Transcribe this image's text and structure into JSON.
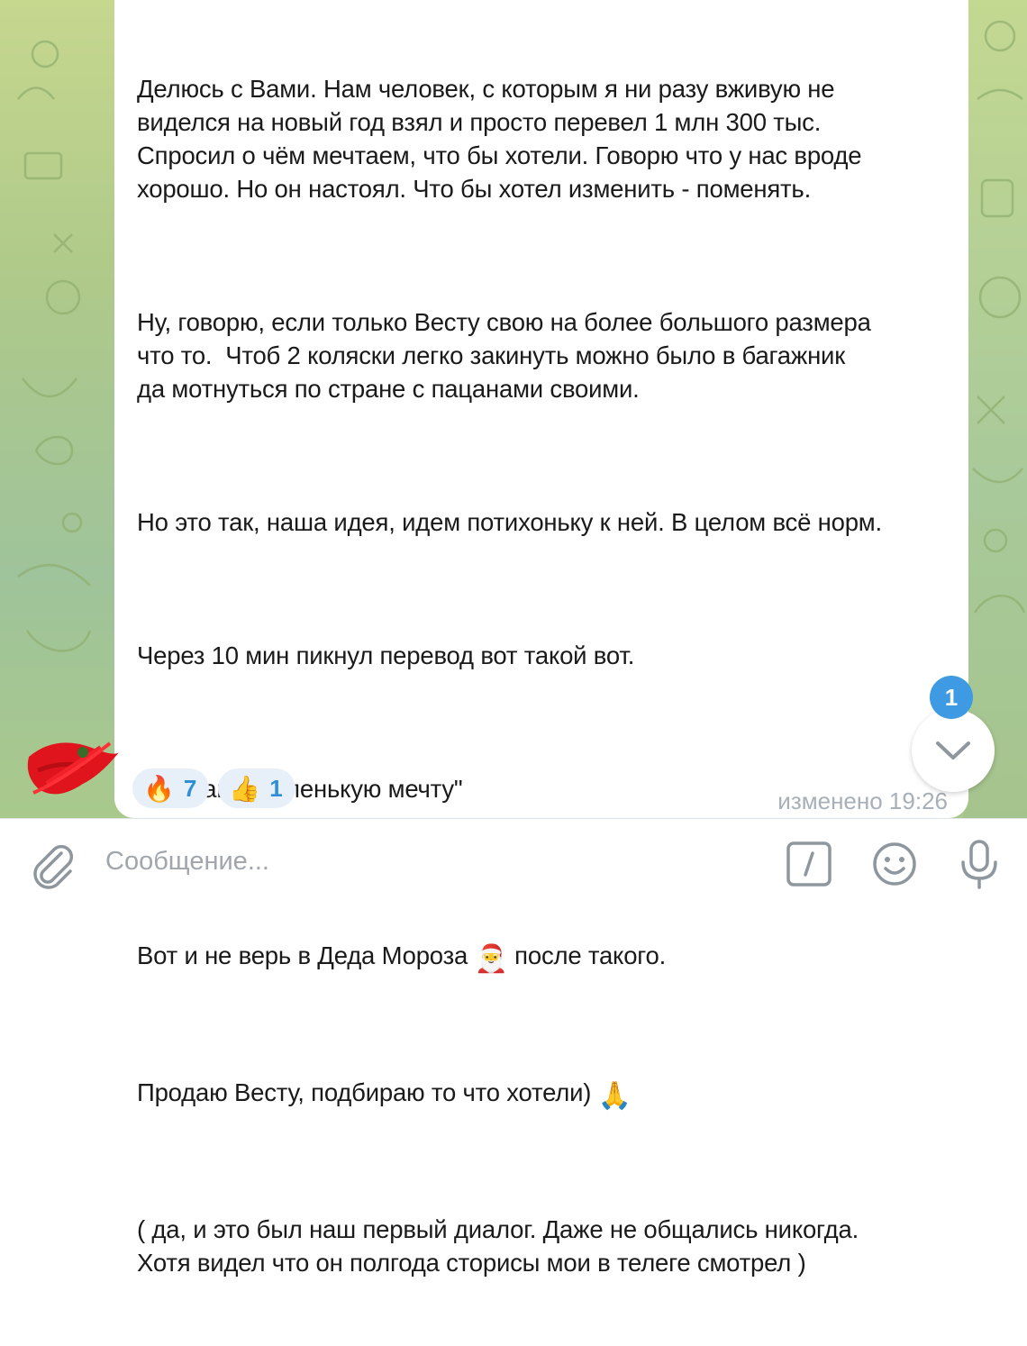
{
  "message": {
    "paragraphs": [
      "Делюсь с Вами. Нам человек, с которым я ни разу вживую не\nвиделся на новый год взял и просто перевел 1 млн 300 тыс.\nСпросил о чём мечтаем, что бы хотели. Говорю что у нас вроде\nхорошо. Но он настоял. Что бы хотел изменить - поменять.",
      "Ну, говорю, если только Весту свою на более большого размера\nчто то.  Чтоб 2 коляски легко закинуть можно было в багажник\nда мотнуться по стране с пацанами своими.",
      "Но это так, наша идея, идем потихоньку к ней. В целом всё норм.",
      "Через 10 мин пикнул перевод вот такой вот.",
      "\" На вашу маленькую мечту\"",
      "( да, и это был наш первый диалог. Даже не общались никогда.\nХотя видел что он полгода сторисы мои в телеге смотрел )"
    ],
    "santa_line_before": "Вот и не верь в Деда Мороза",
    "santa_emoji": "🎅",
    "santa_line_after": "после такого.",
    "sell_line": "Продаю Весту, подбираю то что хотели)",
    "pray_emoji": "🙏",
    "edited_label": "изменено 19:26"
  },
  "reactions": [
    {
      "emoji": "🔥",
      "count": "7"
    },
    {
      "emoji": "👍",
      "count": "1"
    }
  ],
  "scroll_down": {
    "unread_count": "1"
  },
  "composer": {
    "placeholder": "Сообщение..."
  },
  "icons": [
    "attach-icon",
    "commands-icon",
    "emoji-icon",
    "microphone-icon",
    "chevron-down-icon"
  ],
  "colors": {
    "accent": "#3d9ae3",
    "reaction_bg": "#e7f0f8",
    "reaction_count": "#2f8fd6",
    "meta_text": "#a7b0b7"
  }
}
